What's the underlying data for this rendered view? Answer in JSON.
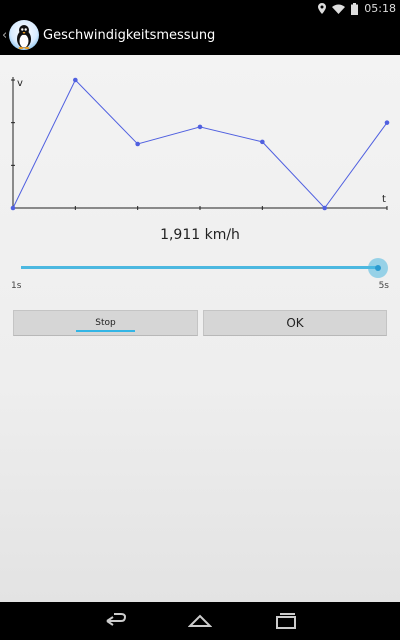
{
  "status_bar": {
    "time": "05:18"
  },
  "app": {
    "title": "Geschwindigkeitsmessung"
  },
  "chart_data": {
    "type": "line",
    "xlabel": "t",
    "ylabel": "v",
    "x": [
      0,
      1,
      2,
      3,
      4,
      5,
      6
    ],
    "values": [
      0,
      3.0,
      1.5,
      1.9,
      1.55,
      0,
      2.0
    ],
    "ylim": [
      0,
      3.0
    ],
    "grid": false,
    "color": "#5060e0"
  },
  "speed_readout": "1,911 km/h",
  "seekbar": {
    "min_label": "1s",
    "max_label": "5s",
    "value_fraction": 1.0
  },
  "buttons": {
    "stop_label": "Stop",
    "ok_label": "OK"
  },
  "colors": {
    "accent": "#33b5e5",
    "series": "#5060e0"
  }
}
